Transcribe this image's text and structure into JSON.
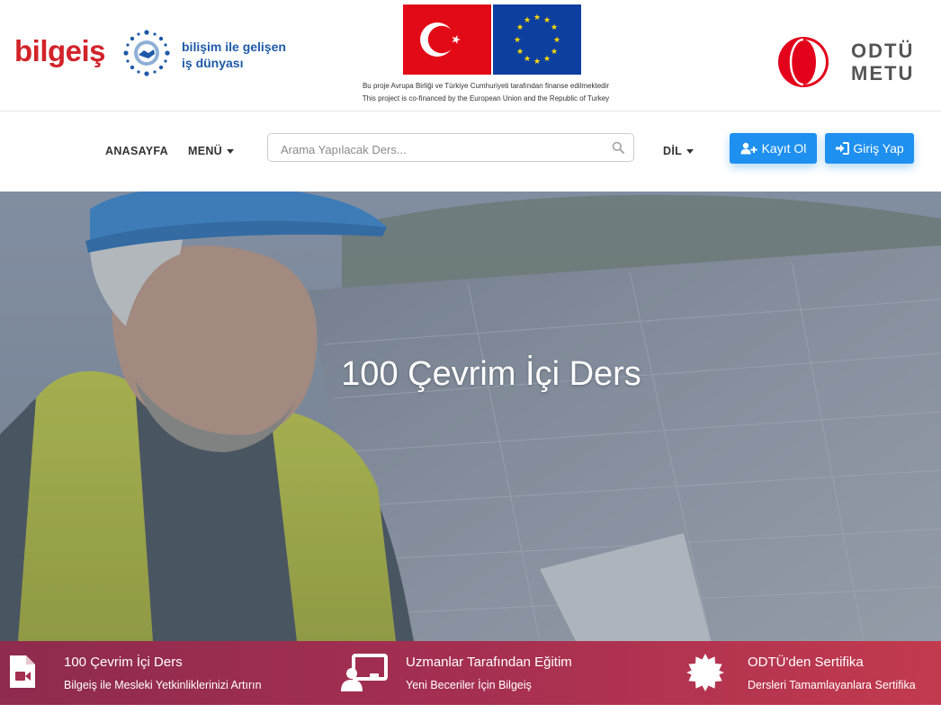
{
  "header": {
    "bilgeis_logo": {
      "word": "bilgeiş",
      "tagline_line1": "bilişim ile gelişen",
      "tagline_line2": "iş dünyası"
    },
    "funding_note_tr": "Bu proje Avrupa Birliği ve Türkiye Cumhuriyeti tarafından finanse edilmektedir",
    "funding_note_en": "This project is co-financed by the European Union and the Republic of Turkey",
    "metu_logo": {
      "line1": "ODTÜ",
      "line2": "METU"
    }
  },
  "nav": {
    "home": "ANASAYFA",
    "menu": "MENÜ",
    "search_placeholder": "Arama Yapılacak Ders...",
    "language": "DİL",
    "register_label": "Kayıt Ol",
    "login_label": "Giriş Yap"
  },
  "hero": {
    "title": "100 Çevrim İçi Ders"
  },
  "features": [
    {
      "title": "100 Çevrim İçi Ders",
      "subtitle": "Bilgeiş ile Mesleki Yetkinliklerinizi Artırın",
      "icon": "video-file-icon"
    },
    {
      "title": "Uzmanlar Tarafından Eğitim",
      "subtitle": "Yeni Beceriler İçin Bilgeiş",
      "icon": "instructor-icon"
    },
    {
      "title": "ODTÜ'den Sertifika",
      "subtitle": "Dersleri Tamamlayanlara Sertifika",
      "icon": "certificate-seal-icon"
    }
  ],
  "colors": {
    "bilgeis_red": "#d2232a",
    "bilgeis_blue": "#1e5aa8",
    "button_blue": "#1e90f0",
    "feature_bar_start": "#8e2b4e",
    "feature_bar_end": "#c23a4e",
    "metu_red": "#e3001b"
  }
}
